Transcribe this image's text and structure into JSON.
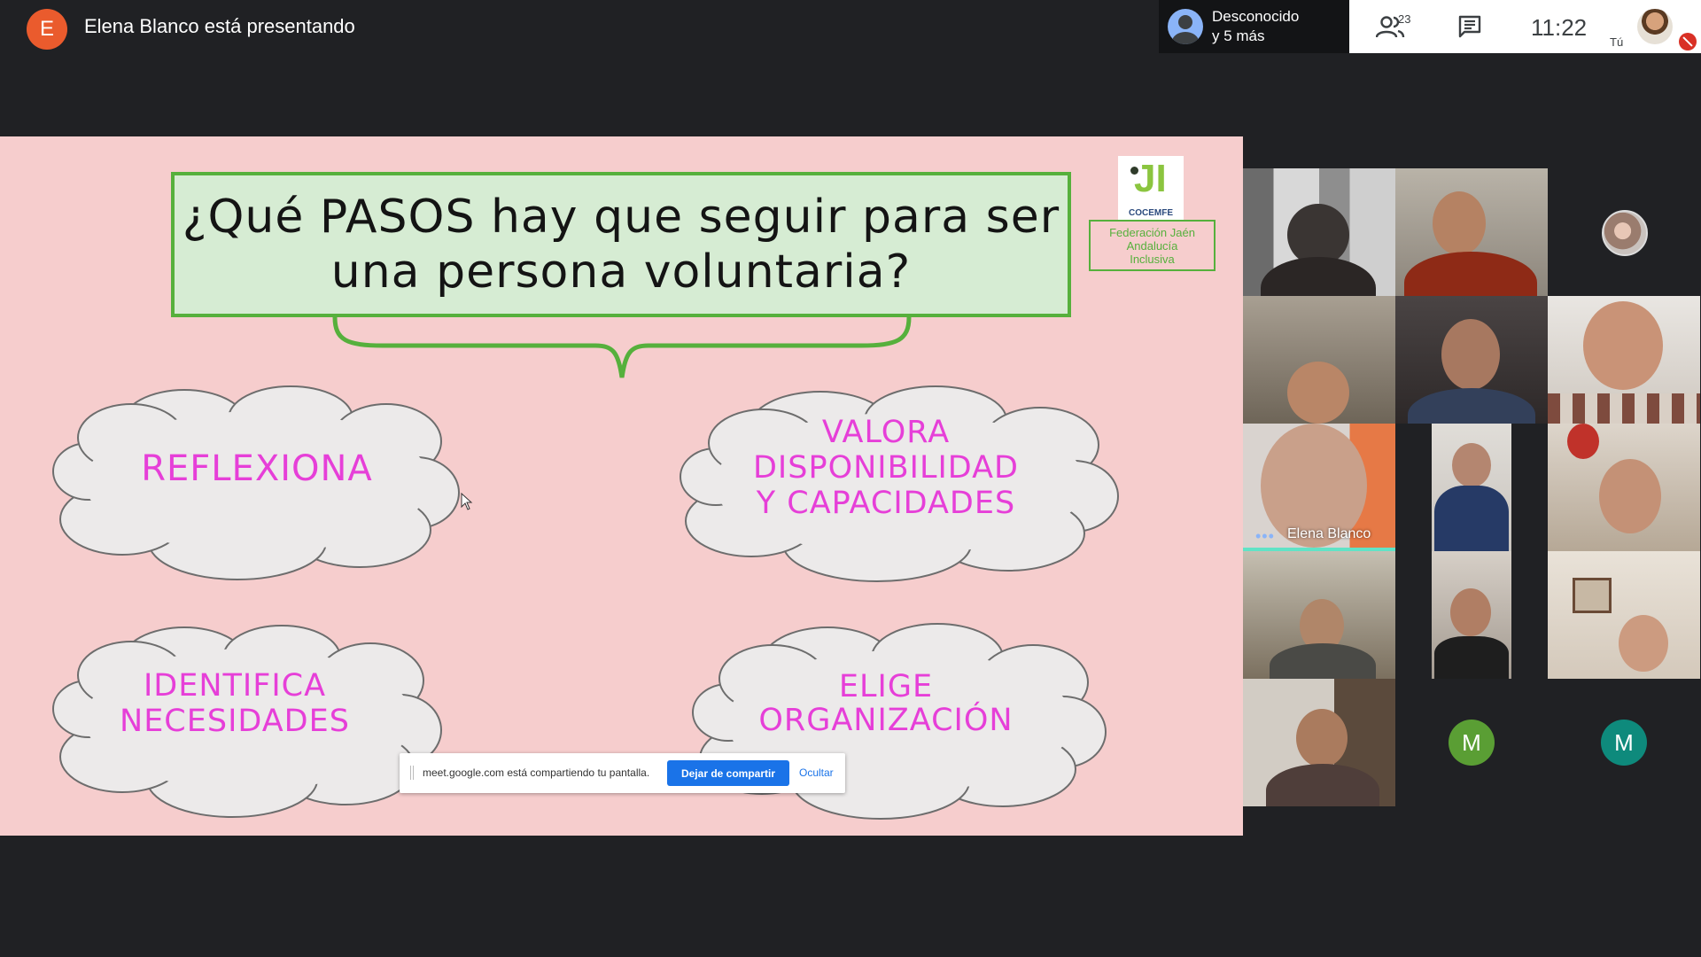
{
  "top_bar": {
    "presenter_initial": "E",
    "presenter_text": "Elena Blanco está presentando",
    "others_line1": "Desconocido",
    "others_line2": "y 5 más",
    "participant_count": "23",
    "time": "11:22",
    "self_label": "Tú"
  },
  "slide": {
    "title_line1": "¿Qué PASOS hay que seguir para ser",
    "title_line2": "una persona voluntaria?",
    "logo_brand": "COCEMFE",
    "logo_org_line1": "Federación Jaén",
    "logo_org_line2": "Andalucía",
    "logo_org_line3": "Inclusiva",
    "steps": [
      {
        "lines": [
          "REFLEXIONA"
        ]
      },
      {
        "lines": [
          "VALORA",
          "DISPONIBILIDAD",
          "Y CAPACIDADES"
        ]
      },
      {
        "lines": [
          "IDENTIFICA",
          "NECESIDADES"
        ]
      },
      {
        "lines": [
          "ELIGE",
          "ORGANIZACIÓN"
        ]
      }
    ],
    "label_color": "#e63fd8",
    "accent_green": "#56b03c"
  },
  "share_bar": {
    "text": "meet.google.com está compartiendo tu pantalla.",
    "stop_label": "Dejar de compartir",
    "hide_label": "Ocultar"
  },
  "participants": {
    "speaker_name": "Elena Blanco",
    "avatar_letter_1": "M",
    "avatar_letter_2": "M",
    "avatar_color_1": "#5a9e34",
    "avatar_color_2": "#0e8a7c"
  }
}
